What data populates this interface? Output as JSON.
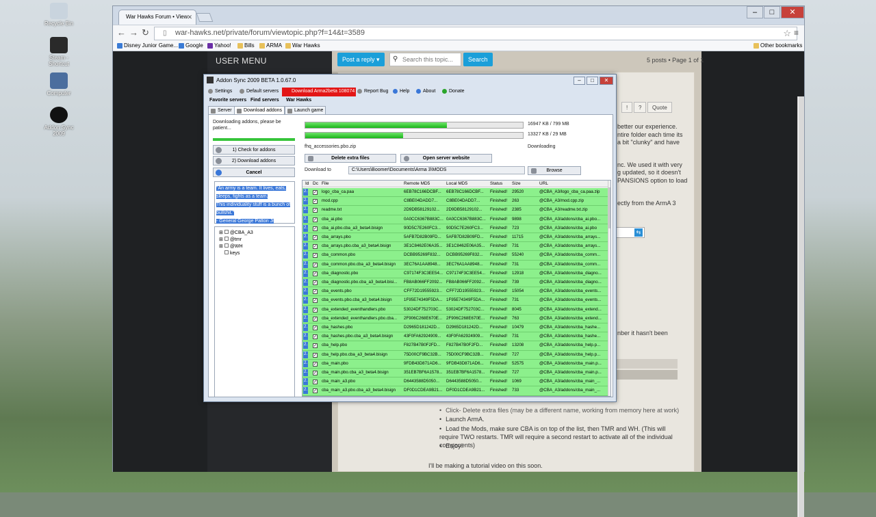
{
  "desktop": {
    "icons": [
      {
        "label": "Recycle Bin"
      },
      {
        "label": "Steam - Shortcut"
      },
      {
        "label": "Computer"
      },
      {
        "label": "Addon Sync 2009"
      }
    ]
  },
  "browser": {
    "tab_title": "War Hawks Forum • View",
    "url": "war-hawks.net/private/forum/viewtopic.php?f=14&t=3589",
    "bookmarks": [
      "Disney Junior Game...",
      "Google",
      "Yahoo!",
      "Bills",
      "ARMA",
      "War Hawks"
    ],
    "other_bookmarks": "Other bookmarks"
  },
  "forum": {
    "user_menu": "USER MENU",
    "post_reply": "Post a reply",
    "search_placeholder": "Search this topic...",
    "search_button": "Search",
    "post_count": "5 posts • Page 1 of 1",
    "buttons": [
      "!",
      "?",
      "Quote"
    ],
    "body_lines": [
      " better our experience.",
      "ntire folder each time its",
      "a bit \"clunky\" and have",
      "nc. We used it with very",
      "g updated, so it doesn't",
      "PANSIONS option to load",
      "ectly from the ArmA 3",
      "nber it hasn't been"
    ],
    "list_items": [
      "Click- Delete extra files (may be a different name, working from memory here at work)",
      "Launch ArmA.",
      "Load the Mods, make sure CBA is on top of the list, then TMR and WH. (This will require TWO restarts. TMR will require a second restart to activate all of the individual components)",
      "Enjoy!"
    ],
    "footer": "I'll be making a tutorial video on this soon."
  },
  "app": {
    "title": "Addon Sync 2009 BETA 1.0.67.0",
    "menu": [
      "Settings",
      "Default servers",
      "Download Arma2beta 108074",
      "Report Bug",
      "Help",
      "About",
      "Donate"
    ],
    "tabs": [
      "Favorite servers",
      "Find servers",
      "War Hawks"
    ],
    "subtabs": [
      "Server",
      "Download addons",
      "Launch game"
    ],
    "status": "Downloading addons, please be patient...",
    "check_btn": "1) Check for addons",
    "download_btn": "2) Download addons",
    "cancel_btn": "Cancel",
    "quote_lines": [
      "\"An army is a team. It lives, eats,",
      "sleeps, fights as a team.",
      "This individuality stuff is a bunch of",
      "bullshit.\"",
      "- General George Patton Jr"
    ],
    "tree": [
      "@CBA_A3",
      "@tmr",
      "@WH",
      "keys"
    ],
    "progress": [
      {
        "label": "16947 KB / 799 MB",
        "fraction": 0.65
      },
      {
        "label": "13327 KB / 29 MB",
        "fraction": 0.45
      }
    ],
    "current_file": "fhq_accessories.pbo.zip",
    "state": "Downloading",
    "delete_btn": "Delete extra files",
    "open_site_btn": "Open server website",
    "download_to_label": "Download to",
    "download_path": "C:\\Users\\Boomer\\Documents\\Arma 3\\MODS",
    "browse_btn": "Browse",
    "columns": [
      "Id",
      "Dc",
      "File",
      "Remote MD5",
      "Local MD5",
      "Status",
      "Size",
      "URL"
    ],
    "rows": [
      [
        "2.",
        "logo_cba_ca.paa",
        "6EB78C166DCBF...",
        "6EB78C166DCBF...",
        "Finished!",
        "29520",
        "@CBA_A3/logo_cba_ca.paa.zip"
      ],
      [
        "2.",
        "mod.cpp",
        "C8BE04DADD7...",
        "C8BE04DADD7...",
        "Finished!",
        "263",
        "@CBA_A3/mod.cpp.zip"
      ],
      [
        "2.",
        "readme.txt",
        "2D9DB58129102...",
        "2D9DB58129102...",
        "Finished!",
        "2385",
        "@CBA_A3/readme.txt.zip"
      ],
      [
        "2.",
        "cba_ai.pbo",
        "0A0CC6367B883C...",
        "0A0CC6367B883C...",
        "Finished!",
        "9898",
        "@CBA_A3/addons/cba_ai.pbo..."
      ],
      [
        "2.",
        "cba_ai.pbo.cba_a3_beta4.bisign",
        "90D5C7E260FC3...",
        "90D5C7E260FC3...",
        "Finished!",
        "723",
        "@CBA_A3/addons/cba_ai.pbo"
      ],
      [
        "2.",
        "cba_arrays.pbo",
        "5AFB7D82B09FD...",
        "5AFB7D82B09FD...",
        "Finished!",
        "11715",
        "@CBA_A3/addons/cba_arrays..."
      ],
      [
        "2.",
        "cba_arrays.pbo.cba_a3_beta4.bisign",
        "3E1C8462E06A35...",
        "3E1C8462E06A35...",
        "Finished!",
        "731",
        "@CBA_A3/addons/cba_arrays..."
      ],
      [
        "2.",
        "cba_common.pbo",
        "DCBB95269F832...",
        "DCBB95269F832...",
        "Finished!",
        "55240",
        "@CBA_A3/addons/cba_comm..."
      ],
      [
        "2.",
        "cba_common.pbo.cba_a3_beta4.bisign",
        "3EC76A1AA8948...",
        "3EC76A1AA8948...",
        "Finished!",
        "731",
        "@CBA_A3/addons/cba_comm..."
      ],
      [
        "2.",
        "cba_diagnostic.pbo",
        "C97174F3C3EE54...",
        "C97174F3C3EE54...",
        "Finished!",
        "12918",
        "@CBA_A3/addons/cba_diagno..."
      ],
      [
        "2.",
        "cba_diagnostic.pbo.cba_a3_beta4.bisi...",
        "FB8AB066FF2092...",
        "FB8AB066FF2092...",
        "Finished!",
        "739",
        "@CBA_A3/addons/cba_diagno..."
      ],
      [
        "2.",
        "cba_events.pbo",
        "CFF72D19555923...",
        "CFF72D19555923...",
        "Finished!",
        "15054",
        "@CBA_A3/addons/cba_events..."
      ],
      [
        "2.",
        "cba_events.pbo.cba_a3_beta4.bisign",
        "1F95E74349F5DA...",
        "1F95E74349F5DA...",
        "Finished!",
        "731",
        "@CBA_A3/addons/cba_events..."
      ],
      [
        "2.",
        "cba_extended_eventhandlers.pbo",
        "53024DF752703C...",
        "53024DF752703C...",
        "Finished!",
        "8045",
        "@CBA_A3/addons/cba_extend..."
      ],
      [
        "2.",
        "cba_extended_eventhandlers.pbo.cba...",
        "2F906C268E670E...",
        "2F906C268E670E...",
        "Finished!",
        "763",
        "@CBA_A3/addons/cba_extend..."
      ],
      [
        "2.",
        "cba_hashes.pbo",
        "D2965D181242D...",
        "D2965D181242D...",
        "Finished!",
        "10479",
        "@CBA_A3/addons/cba_hashe..."
      ],
      [
        "2.",
        "cba_hashes.pbo.cba_a3_beta4.bisign",
        "43F0FA62924909...",
        "43F0FA62924909...",
        "Finished!",
        "731",
        "@CBA_A3/addons/cba_hashe..."
      ],
      [
        "2.",
        "cba_help.pbo",
        "F827B47B0F2FD...",
        "F827B47B0F2FD...",
        "Finished!",
        "13208",
        "@CBA_A3/addons/cba_help.p..."
      ],
      [
        "2.",
        "cba_help.pbo.cba_a3_beta4.bisign",
        "75D00CF9BC32B...",
        "75D00CF9BC32B...",
        "Finished!",
        "727",
        "@CBA_A3/addons/cba_help.p..."
      ],
      [
        "2.",
        "cba_main.pbo",
        "9FDB43D871AD6...",
        "9FDB43D871AD6...",
        "Finished!",
        "52575",
        "@CBA_A3/addons/cba_main.p..."
      ],
      [
        "2.",
        "cba_main.pbo.cba_a3_beta4.bisign",
        "351EB7BF6A1578...",
        "351EB7BF6A1578...",
        "Finished!",
        "727",
        "@CBA_A3/addons/cba_main.p..."
      ],
      [
        "2.",
        "cba_main_a3.pbo",
        "D6443588D5050...",
        "D6443588D5050...",
        "Finished!",
        "1069",
        "@CBA_A3/addons/cba_main_..."
      ],
      [
        "2.",
        "cba_main_a3.pbo.cba_a3_beta4.bisign",
        "DF0D1CDEA9B21...",
        "DF0D1CDEA9B21...",
        "Finished!",
        "733",
        "@CBA_A3/addons/cba_main_..."
      ]
    ]
  }
}
